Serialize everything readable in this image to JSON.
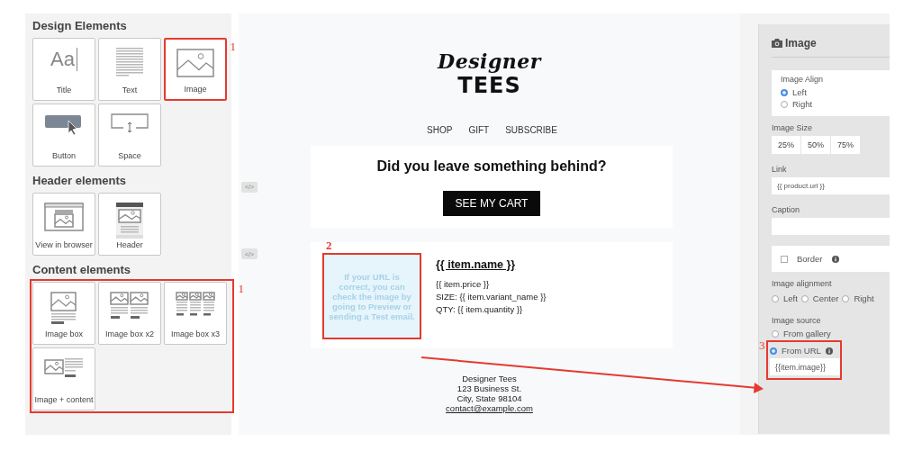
{
  "design_elements": {
    "title": "Design Elements",
    "tiles": [
      {
        "kind": "title",
        "glyph": "Aa",
        "label": "Title",
        "highlighted": false
      },
      {
        "kind": "text",
        "label": "Text",
        "highlighted": false
      },
      {
        "kind": "image",
        "label": "Image",
        "highlighted": true,
        "callout": "1"
      },
      {
        "kind": "button",
        "label": "Button",
        "highlighted": false
      },
      {
        "kind": "space",
        "label": "Space",
        "highlighted": false
      }
    ]
  },
  "header_elements": {
    "title": "Header elements",
    "tiles": [
      {
        "kind": "browser",
        "label": "View in browser",
        "highlighted": false
      },
      {
        "kind": "header",
        "label": "Header",
        "highlighted": false
      }
    ]
  },
  "content_elements": {
    "title": "Content elements",
    "highlighted": true,
    "callout": "1",
    "tiles": [
      {
        "kind": "image_box",
        "label": "Image box",
        "highlighted": false
      },
      {
        "kind": "image_box_x2",
        "label": "Image box x2",
        "highlighted": false
      },
      {
        "kind": "image_box_x3",
        "label": "Image box x3",
        "highlighted": false
      },
      {
        "kind": "image_content",
        "label": "Image + content",
        "highlighted": false
      }
    ]
  },
  "email": {
    "logo": {
      "script": "Designer",
      "title": "TEES"
    },
    "nav": [
      "SHOP",
      "GIFT",
      "SUBSCRIBE"
    ],
    "code_toggles": [
      "</>",
      "</>"
    ],
    "hero": {
      "heading": "Did you leave something behind?",
      "button": "SEE MY CART"
    },
    "product": {
      "placeholder": {
        "text": "If your URL is correct, you can check the image by going to Preview or sending a Test email.",
        "highlighted": true,
        "callout": "2"
      },
      "name": "{{ item.name }}",
      "lines": [
        "{{ item.price }}",
        "SIZE: {{ item.variant_name }}",
        "QTY: {{ item.quantity }}"
      ]
    },
    "footer": {
      "lines": [
        "Designer Tees",
        "123 Business St.",
        "City, State 98104"
      ],
      "email": "contact@example.com"
    }
  },
  "properties": {
    "title": "Image",
    "image_align": {
      "label": "Image Align",
      "options": [
        {
          "label": "Left",
          "selected": true
        },
        {
          "label": "Right",
          "selected": false
        }
      ]
    },
    "image_size": {
      "label": "Image Size",
      "options": [
        {
          "label": "25%",
          "selected": false
        },
        {
          "label": "50%",
          "selected": false
        },
        {
          "label": "75%",
          "selected": false
        }
      ]
    },
    "link": {
      "label": "Link",
      "value": "{{ product.url }}"
    },
    "caption": {
      "label": "Caption"
    },
    "border": {
      "label": "Border",
      "checked": false
    },
    "image_alignment": {
      "label": "Image alignment",
      "options": [
        {
          "label": "Left",
          "selected": false
        },
        {
          "label": "Center",
          "selected": false
        },
        {
          "label": "Right",
          "selected": false
        }
      ]
    },
    "image_source": {
      "label": "Image source",
      "options": [
        {
          "label": "From gallery",
          "selected": false
        },
        {
          "label": "From URL",
          "selected": true
        }
      ],
      "url": "{{item.image}}",
      "highlighted": true,
      "callout": "3"
    }
  }
}
